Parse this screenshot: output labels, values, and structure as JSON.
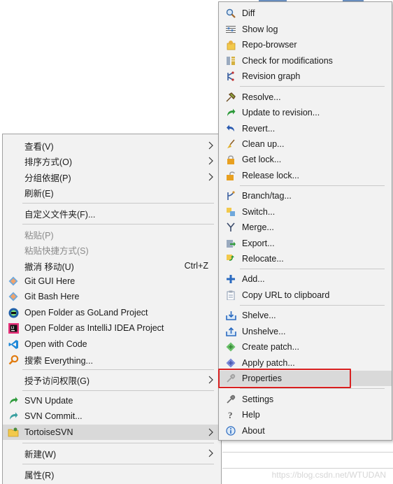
{
  "left_menu": {
    "items": [
      {
        "label": "查看(V)"
      },
      {
        "label": "排序方式(O)"
      },
      {
        "label": "分组依据(P)"
      },
      {
        "label": "刷新(E)"
      },
      {
        "label": "自定义文件夹(F)..."
      },
      {
        "label": "粘贴(P)"
      },
      {
        "label": "粘贴快捷方式(S)"
      },
      {
        "label": "撤消 移动(U)",
        "shortcut": "Ctrl+Z"
      },
      {
        "label": "Git GUI Here"
      },
      {
        "label": "Git Bash Here"
      },
      {
        "label": "Open Folder as GoLand Project"
      },
      {
        "label": "Open Folder as IntelliJ IDEA Project"
      },
      {
        "label": "Open with Code"
      },
      {
        "label": "搜索 Everything..."
      },
      {
        "label": "授予访问权限(G)"
      },
      {
        "label": "SVN Update"
      },
      {
        "label": "SVN Commit..."
      },
      {
        "label": "TortoiseSVN"
      },
      {
        "label": "新建(W)"
      },
      {
        "label": "属性(R)"
      }
    ]
  },
  "right_menu": {
    "items": [
      {
        "label": "Diff"
      },
      {
        "label": "Show log"
      },
      {
        "label": "Repo-browser"
      },
      {
        "label": "Check for modifications"
      },
      {
        "label": "Revision graph"
      },
      {
        "label": "Resolve..."
      },
      {
        "label": "Update to revision..."
      },
      {
        "label": "Revert..."
      },
      {
        "label": "Clean up..."
      },
      {
        "label": "Get lock..."
      },
      {
        "label": "Release lock..."
      },
      {
        "label": "Branch/tag..."
      },
      {
        "label": "Switch..."
      },
      {
        "label": "Merge..."
      },
      {
        "label": "Export..."
      },
      {
        "label": "Relocate..."
      },
      {
        "label": "Add..."
      },
      {
        "label": "Copy URL to clipboard"
      },
      {
        "label": "Shelve..."
      },
      {
        "label": "Unshelve..."
      },
      {
        "label": "Create patch..."
      },
      {
        "label": "Apply patch..."
      },
      {
        "label": "Properties"
      },
      {
        "label": "Settings"
      },
      {
        "label": "Help"
      },
      {
        "label": "About"
      }
    ]
  },
  "watermark": "https://blog.csdn.net/WTUDAN"
}
